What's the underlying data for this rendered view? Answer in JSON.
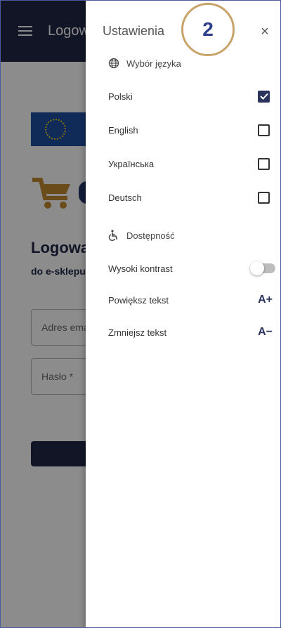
{
  "app": {
    "title": "Logowanie"
  },
  "login": {
    "heading": "Logowanie",
    "subheading": "do e-sklepu",
    "email_placeholder": "Adres email",
    "password_placeholder": "Hasło *"
  },
  "drawer": {
    "title": "Ustawienia",
    "close_label": "×",
    "language_section": {
      "title": "Wybór języka",
      "options": [
        {
          "label": "Polski",
          "checked": true
        },
        {
          "label": "English",
          "checked": false
        },
        {
          "label": "Українська",
          "checked": false
        },
        {
          "label": "Deutsch",
          "checked": false
        }
      ]
    },
    "accessibility_section": {
      "title": "Dostępność",
      "high_contrast": {
        "label": "Wysoki kontrast",
        "enabled": false
      },
      "increase_text": {
        "label": "Powiększ tekst",
        "action": "A+"
      },
      "decrease_text": {
        "label": "Zmniejsz tekst",
        "action": "A−"
      }
    }
  },
  "annotation": {
    "step": "2"
  },
  "colors": {
    "primary_dark": "#1f2746",
    "accent_navy": "#2a335c",
    "badge_border": "#c9a46a",
    "badge_text": "#2d3e8c",
    "flag_blue": "#1f4fa3",
    "cart_orange": "#c08a2e"
  }
}
